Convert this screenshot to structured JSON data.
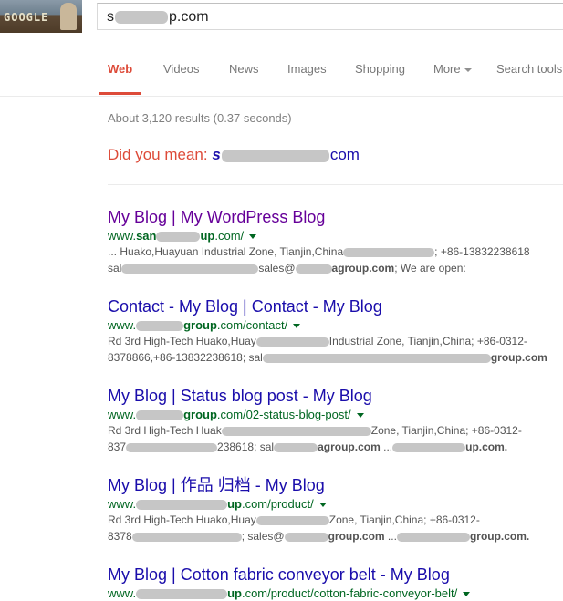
{
  "header": {
    "doodle_text": "GOOGLE",
    "search_query_prefix": "s",
    "search_query_suffix": "p.com"
  },
  "nav": {
    "tabs": [
      {
        "label": "Web",
        "active": true
      },
      {
        "label": "Videos"
      },
      {
        "label": "News"
      },
      {
        "label": "Images"
      },
      {
        "label": "Shopping"
      },
      {
        "label": "More"
      },
      {
        "label": "Search tools"
      }
    ]
  },
  "stats": "About 3,120 results (0.37 seconds)",
  "did_you_mean": {
    "label": "Did you mean:",
    "link_prefix": "s",
    "link_suffix": "com"
  },
  "results": [
    {
      "title": "My Blog | My WordPress Blog",
      "url_prefix": "www.",
      "url_bold": "san",
      "url_bold2": "up",
      "url_suffix": ".com/",
      "snippet1_a": "... Huako,Huayuan Industrial Zone, Tianjin,China",
      "snippet1_b": "; +86-13832238618",
      "snippet2_a": "sal",
      "snippet2_b": "sales@",
      "snippet2_c": "agroup.com",
      "snippet2_d": "; We are open:"
    },
    {
      "title": "Contact - My Blog | Contact - My Blog",
      "url_prefix": "www.",
      "url_bold2": "group",
      "url_suffix": ".com/contact/",
      "snippet1_a": "Rd 3rd High-Tech Huako,Huay",
      "snippet1_b": "Industrial Zone, Tianjin,China; +86-0312-",
      "snippet2_a": "8378866,+86-13832238618; sal",
      "snippet2_b": "group.com"
    },
    {
      "title": "My Blog | Status blog post - My Blog",
      "url_prefix": "www.",
      "url_bold2": "group",
      "url_suffix": ".com/02-status-blog-post/",
      "snippet1_a": "Rd 3rd High-Tech Huak",
      "snippet1_b": "Zone, Tianjin,China; +86-0312-",
      "snippet2_a": "837",
      "snippet2_b": "238618; sal",
      "snippet2_c": "agroup.com",
      "snippet2_d": "...",
      "snippet2_e": "up.com."
    },
    {
      "title": "My Blog | 作品 归档 - My Blog",
      "url_prefix": "www.",
      "url_bold2": "up",
      "url_suffix": ".com/product/",
      "snippet1_a": "Rd 3rd High-Tech Huako,Huay",
      "snippet1_b": "Zone, Tianjin,China; +86-0312-",
      "snippet2_a": "8378",
      "snippet2_b": "; sales@",
      "snippet2_c": "group.com",
      "snippet2_d": "...",
      "snippet2_e": "group.com."
    },
    {
      "title": "My Blog | Cotton fabric conveyor belt - My Blog",
      "url_prefix": "www.",
      "url_bold2": "up",
      "url_suffix": ".com/product/cotton-fabric-conveyor-belt/"
    }
  ]
}
